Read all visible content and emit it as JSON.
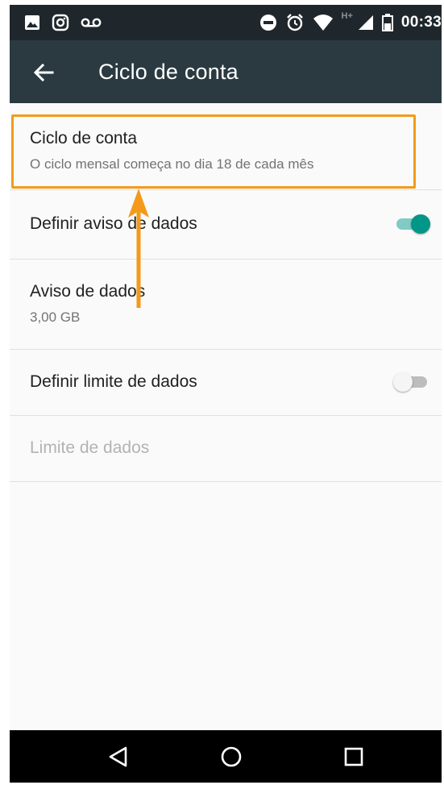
{
  "status_bar": {
    "time": "00:33",
    "network_type": "H+",
    "icons": [
      "image-icon",
      "instagram-icon",
      "voicemail-icon",
      "do-not-disturb-icon",
      "alarm-icon",
      "wifi-icon",
      "signal-icon",
      "battery-icon"
    ]
  },
  "toolbar": {
    "title": "Ciclo de conta",
    "back_icon": "arrow-left-icon"
  },
  "preferences": [
    {
      "id": "billing-cycle",
      "title": "Ciclo de conta",
      "summary": "O ciclo mensal começa no dia 18 de cada mês",
      "highlighted": true
    },
    {
      "id": "set-data-warning",
      "title": "Definir aviso de dados",
      "switch": "on"
    },
    {
      "id": "data-warning",
      "title": "Aviso de dados",
      "summary": "3,00 GB"
    },
    {
      "id": "set-data-limit",
      "title": "Definir limite de dados",
      "switch": "off"
    },
    {
      "id": "data-limit",
      "title": "Limite de dados",
      "enabled": false
    }
  ],
  "colors": {
    "status_bar": "#1f272c",
    "toolbar": "#2b3a41",
    "accent": "#009688",
    "highlight": "#f39a1b",
    "background": "#fafafa"
  },
  "nav_bar": {
    "icons": [
      "back-triangle-icon",
      "home-circle-icon",
      "recents-square-icon"
    ]
  }
}
